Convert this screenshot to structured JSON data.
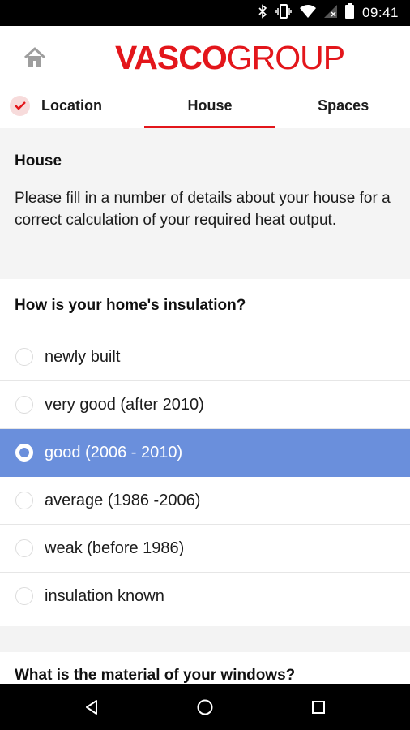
{
  "status_bar": {
    "time": "09:41"
  },
  "header": {
    "logo_bold": "VASCO",
    "logo_light": "GROUP",
    "tabs": [
      {
        "label": "Location",
        "state": "done"
      },
      {
        "label": "House",
        "state": "active"
      },
      {
        "label": "Spaces",
        "state": "inactive"
      }
    ]
  },
  "intro": {
    "title": "House",
    "text": "Please fill in a number of details about your house for a correct calculation of your required heat output."
  },
  "insulation": {
    "question": "How is your home's insulation?",
    "options": [
      {
        "label": "newly built",
        "selected": false
      },
      {
        "label": "very good (after 2010)",
        "selected": false
      },
      {
        "label": "good (2006 - 2010)",
        "selected": true
      },
      {
        "label": "average (1986 -2006)",
        "selected": false
      },
      {
        "label": "weak (before 1986)",
        "selected": false
      },
      {
        "label": "insulation known",
        "selected": false
      }
    ]
  },
  "windows": {
    "question": "What is the material of your windows?"
  },
  "icons": {
    "status": [
      "bluetooth-icon",
      "vibrate-icon",
      "wifi-icon",
      "no-sim-icon",
      "battery-icon"
    ],
    "navigation": [
      "back-icon",
      "home-nav-icon",
      "recents-icon"
    ],
    "header": [
      "home-icon",
      "check-icon"
    ]
  },
  "colors": {
    "brand_red": "#e3161b",
    "selected_blue": "#6a8fdc",
    "check_bg": "#f7dbdb"
  }
}
